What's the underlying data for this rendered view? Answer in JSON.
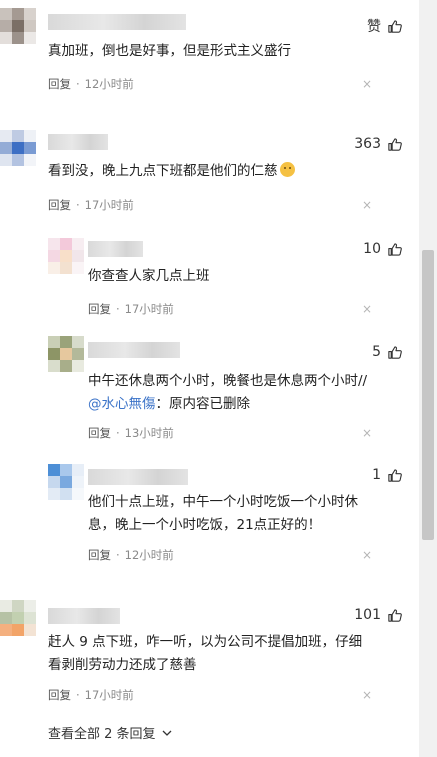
{
  "comments": [
    {
      "likes": "赞",
      "text": "真加班，倒也是好事，但是形式主义盛行",
      "reply": "回复",
      "time": "12小时前",
      "close": "×"
    },
    {
      "likes": "363",
      "text": "看到没，晚上九点下班都是他们的仁慈",
      "reply": "回复",
      "time": "17小时前",
      "close": "×"
    }
  ],
  "replies": [
    {
      "likes": "10",
      "text": "你查查人家几点上班",
      "reply": "回复",
      "time": "17小时前",
      "close": "×"
    },
    {
      "likes": "5",
      "text": "中午还休息两个小时，晚餐也是休息两个小时//",
      "mention": "@水心無傷",
      "text_tail": "：原内容已删除",
      "reply": "回复",
      "time": "13小时前",
      "close": "×"
    },
    {
      "likes": "1",
      "text_line1": "他们十点上班，中午一个小时吃饭一个小时休",
      "text_line2": "息，晚上一个小时吃饭，21点正好的！",
      "reply": "回复",
      "time": "12小时前",
      "close": "×"
    }
  ],
  "comment3": {
    "likes": "101",
    "text_line1": "赶人 9 点下班，咋一听，以为公司不提倡加班，仔细",
    "text_line2": "看剥削劳动力还成了慈善",
    "reply": "回复",
    "time": "17小时前",
    "close": "×"
  },
  "view_all": "查看全部 2 条回复",
  "dot": "·",
  "colors": {
    "mention": "#3b73c8",
    "meta": "#8a8a8a"
  }
}
